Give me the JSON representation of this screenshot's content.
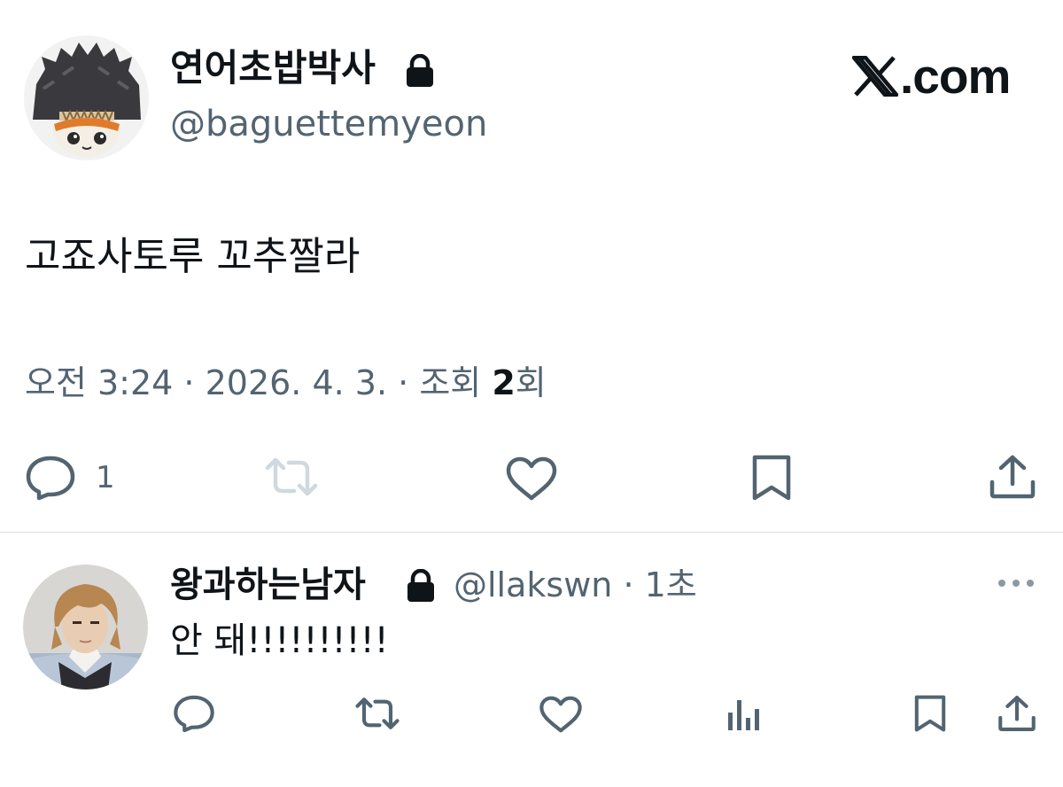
{
  "brand": {
    "logo_text": ".com"
  },
  "tweet": {
    "author_name": "연어초밥박사",
    "author_handle": "@baguettemyeon",
    "text": "고죠사토루 꼬추짤라",
    "time": "오전 3:24",
    "sep1": " · ",
    "date": "2026. 4. 3.",
    "sep2": " · ",
    "views_label": "조회 ",
    "views_count": "2",
    "views_suffix": "회",
    "reply_count": "1"
  },
  "reply": {
    "author_name": "왕과하는남자",
    "author_handle": "@llakswn · 1초",
    "text": "안 돼!!!!!!!!!!"
  },
  "colors": {
    "text": "#0f1419",
    "secondary": "#536471",
    "disabled": "#cfd9de",
    "divider": "#dbe1e6"
  },
  "icons": {
    "lock": "lock-icon",
    "reply": "reply-icon",
    "retweet": "retweet-icon",
    "like": "heart-icon",
    "bookmark": "bookmark-icon",
    "share": "share-icon",
    "views": "bar-chart-icon",
    "more": "more-icon"
  }
}
